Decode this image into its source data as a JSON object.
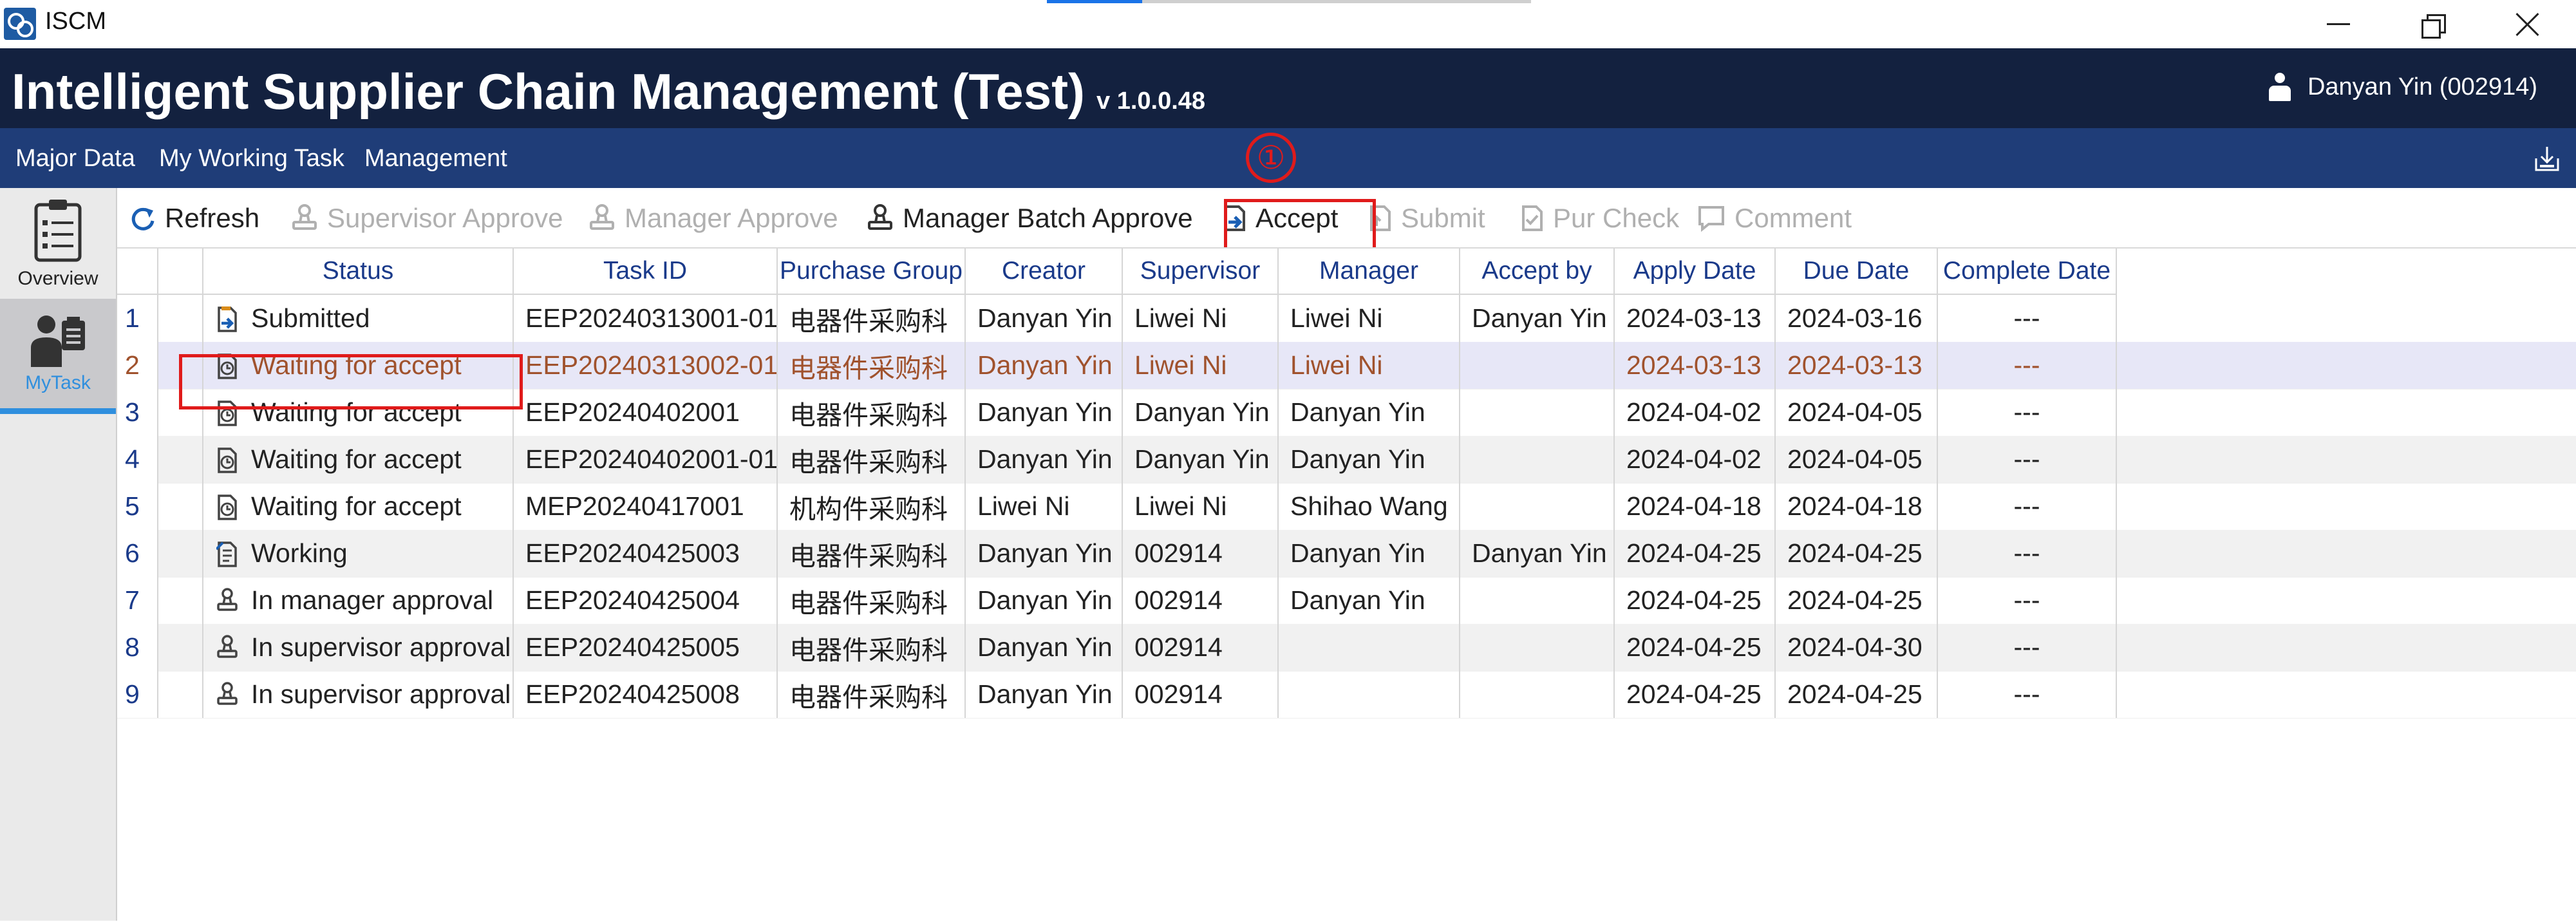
{
  "window": {
    "app_name": "ISCM",
    "buttons": [
      "minimize",
      "restore",
      "close"
    ]
  },
  "banner": {
    "title": "Intelligent Supplier Chain Management (Test)",
    "version": "v 1.0.0.48",
    "user": "Danyan Yin (002914)"
  },
  "menu": {
    "items": [
      "Major Data",
      "My Working Task",
      "Management"
    ]
  },
  "sidenav": {
    "items": [
      {
        "label": "Overview",
        "icon": "clipboard-list-icon",
        "active": false
      },
      {
        "label": "MyTask",
        "icon": "person-task-icon",
        "active": true
      }
    ]
  },
  "toolbar": {
    "refresh": "Refresh",
    "supervisor_approve": "Supervisor Approve",
    "manager_approve": "Manager Approve",
    "manager_batch_approve": "Manager Batch Approve",
    "accept": "Accept",
    "submit": "Submit",
    "pur_check": "Pur Check",
    "comment": "Comment"
  },
  "annotation": {
    "step_marker": "①"
  },
  "grid": {
    "columns": [
      "",
      "",
      "Status",
      "Task ID",
      "Purchase Group",
      "Creator",
      "Supervisor",
      "Manager",
      "Accept by",
      "Apply Date",
      "Due Date",
      "Complete Date"
    ],
    "rows": [
      {
        "num": "1",
        "status": "Submitted",
        "status_icon": "doc-arrow-icon",
        "task_id": "EEP20240313001-01",
        "purchase_group": "电器件采购科",
        "creator": "Danyan Yin",
        "supervisor": "Liwei Ni",
        "manager": "Liwei Ni",
        "accept_by": "Danyan Yin",
        "apply_date": "2024-03-13",
        "due_date": "2024-03-16",
        "complete_date": "---"
      },
      {
        "num": "2",
        "status": "Waiting for accept",
        "status_icon": "clock-doc-icon",
        "task_id": "EEP20240313002-01",
        "purchase_group": "电器件采购科",
        "creator": "Danyan Yin",
        "supervisor": "Liwei Ni",
        "manager": "Liwei Ni",
        "accept_by": "",
        "apply_date": "2024-03-13",
        "due_date": "2024-03-13",
        "complete_date": "---"
      },
      {
        "num": "3",
        "status": "Waiting for accept",
        "status_icon": "clock-doc-icon",
        "task_id": "EEP20240402001",
        "purchase_group": "电器件采购科",
        "creator": "Danyan Yin",
        "supervisor": "Danyan Yin",
        "manager": "Danyan Yin",
        "accept_by": "",
        "apply_date": "2024-04-02",
        "due_date": "2024-04-05",
        "complete_date": "---"
      },
      {
        "num": "4",
        "status": "Waiting for accept",
        "status_icon": "clock-doc-icon",
        "task_id": "EEP20240402001-01",
        "purchase_group": "电器件采购科",
        "creator": "Danyan Yin",
        "supervisor": "Danyan Yin",
        "manager": "Danyan Yin",
        "accept_by": "",
        "apply_date": "2024-04-02",
        "due_date": "2024-04-05",
        "complete_date": "---"
      },
      {
        "num": "5",
        "status": "Waiting for accept",
        "status_icon": "clock-doc-icon",
        "task_id": "MEP20240417001",
        "purchase_group": "机构件采购科",
        "creator": "Liwei Ni",
        "supervisor": "Liwei Ni",
        "manager": "Shihao Wang",
        "accept_by": "",
        "apply_date": "2024-04-18",
        "due_date": "2024-04-18",
        "complete_date": "---"
      },
      {
        "num": "6",
        "status": "Working",
        "status_icon": "working-doc-icon",
        "task_id": "EEP20240425003",
        "purchase_group": "电器件采购科",
        "creator": "Danyan Yin",
        "supervisor": "002914",
        "manager": "Danyan Yin",
        "accept_by": "Danyan Yin",
        "apply_date": "2024-04-25",
        "due_date": "2024-04-25",
        "complete_date": "---"
      },
      {
        "num": "7",
        "status": "In manager approval",
        "status_icon": "stamp-icon",
        "task_id": "EEP20240425004",
        "purchase_group": "电器件采购科",
        "creator": "Danyan Yin",
        "supervisor": "002914",
        "manager": "Danyan Yin",
        "accept_by": "",
        "apply_date": "2024-04-25",
        "due_date": "2024-04-25",
        "complete_date": "---"
      },
      {
        "num": "8",
        "status": "In supervisor approval",
        "status_icon": "stamp-icon",
        "task_id": "EEP20240425005",
        "purchase_group": "电器件采购科",
        "creator": "Danyan Yin",
        "supervisor": "002914",
        "manager": "",
        "accept_by": "",
        "apply_date": "2024-04-25",
        "due_date": "2024-04-30",
        "complete_date": "---"
      },
      {
        "num": "9",
        "status": "In supervisor approval",
        "status_icon": "stamp-icon",
        "task_id": "EEP20240425008",
        "purchase_group": "电器件采购科",
        "creator": "Danyan Yin",
        "supervisor": "002914",
        "manager": "",
        "accept_by": "",
        "apply_date": "2024-04-25",
        "due_date": "2024-04-25",
        "complete_date": "---"
      }
    ],
    "selected_row": "2"
  },
  "colors": {
    "banner_bg": "#13213f",
    "menu_bg": "#1f3d78",
    "header_text": "#1a3a8a",
    "selected_row_text": "#a0522d",
    "annotation_red": "#e01b1b",
    "active_nav_accent": "#2f8fde"
  }
}
